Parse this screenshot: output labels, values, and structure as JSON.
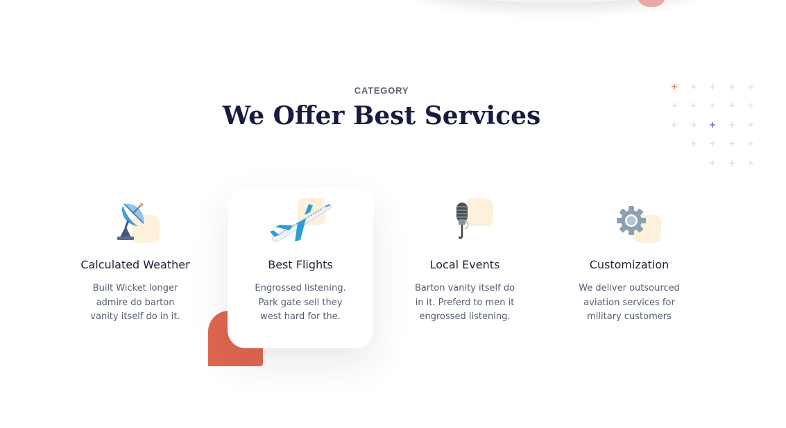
{
  "section": {
    "subtitle": "CATEGORY",
    "title": "We Offer Best Services"
  },
  "services": [
    {
      "title": "Calculated Weather",
      "icon": "satellite-dish-icon",
      "description": [
        "Built Wicket longer",
        "admire do barton",
        "vanity itself do in it."
      ]
    },
    {
      "title": "Best Flights",
      "icon": "airplane-icon",
      "description": [
        "Engrossed listening.",
        "Park gate sell they",
        "west hard for the."
      ]
    },
    {
      "title": "Local Events",
      "icon": "microphone-icon",
      "description": [
        "Barton vanity itself do",
        "in it. Preferd to men it",
        "engrossed listening."
      ]
    },
    {
      "title": "Customization",
      "icon": "gear-icon",
      "description": [
        "We deliver outsourced",
        "aviation services for",
        "military customers"
      ]
    }
  ],
  "colors": {
    "heading": "#181b40",
    "accent": "#e0674f",
    "icon_bg": "#fdf1dc",
    "plus_default": "#d9dbe4",
    "plus_orange": "#e0674f",
    "plus_purple": "#5b4fd6"
  }
}
